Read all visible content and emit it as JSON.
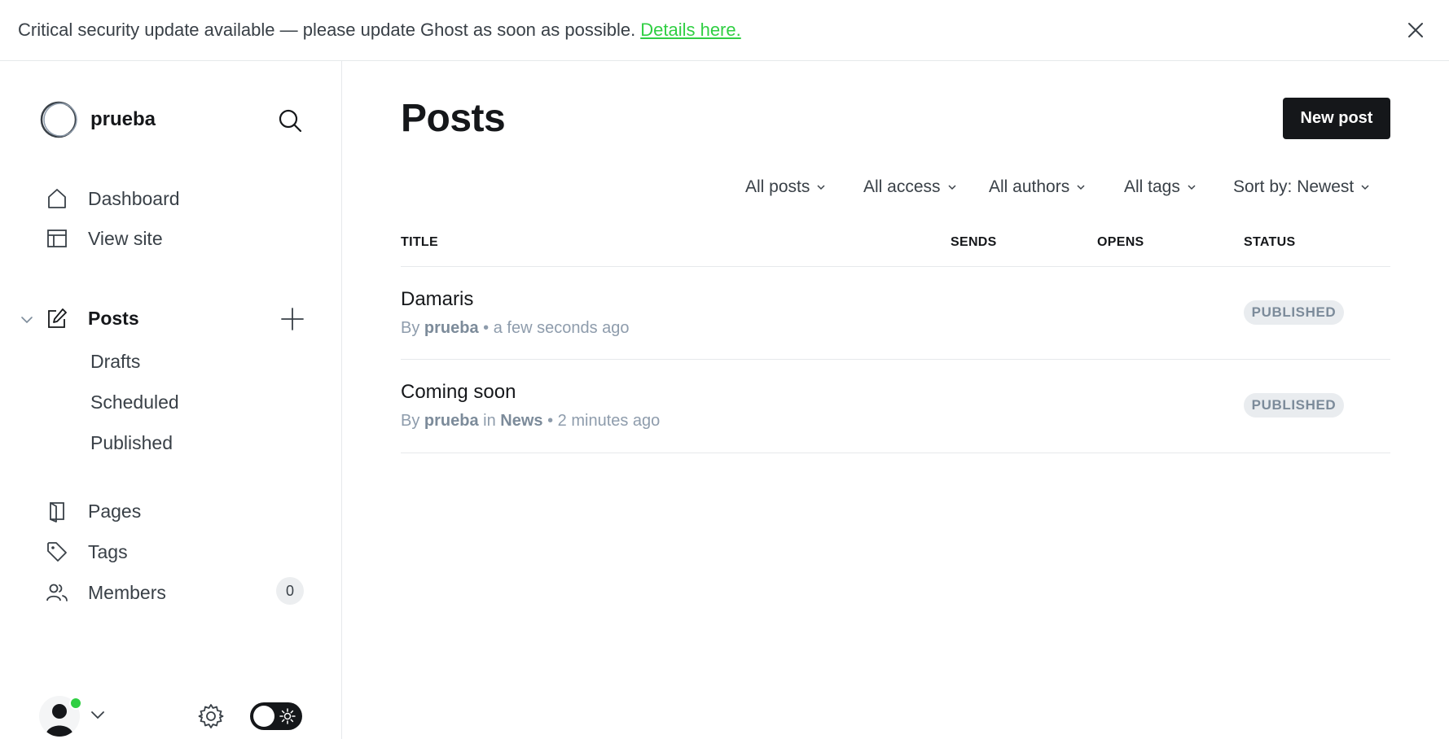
{
  "banner": {
    "message": "Critical security update available — please update Ghost as soon as possible.",
    "link_label": "Details here."
  },
  "site": {
    "name": "prueba"
  },
  "nav": {
    "dashboard": "Dashboard",
    "view_site": "View site",
    "posts": "Posts",
    "drafts": "Drafts",
    "scheduled": "Scheduled",
    "published": "Published",
    "pages": "Pages",
    "tags": "Tags",
    "members": "Members",
    "members_count": "0"
  },
  "main": {
    "title": "Posts",
    "new_post_label": "New post",
    "filters": {
      "type": "All posts",
      "access": "All access",
      "authors": "All authors",
      "tags": "All tags",
      "sort": "Sort by: Newest"
    },
    "columns": {
      "title": "TITLE",
      "sends": "SENDS",
      "opens": "OPENS",
      "status": "STATUS"
    },
    "posts": [
      {
        "title": "Damaris",
        "by": "By",
        "author": "prueba",
        "in": "",
        "tag": "",
        "time": "• a few seconds ago",
        "status": "PUBLISHED"
      },
      {
        "title": "Coming soon",
        "by": "By",
        "author": "prueba",
        "in": "in",
        "tag": "News",
        "time": "• 2 minutes ago",
        "status": "PUBLISHED"
      }
    ]
  },
  "colors": {
    "accent": "#30cf43",
    "dark": "#15171a",
    "badge_bg": "#e9ecef",
    "muted": "#8e9cac"
  }
}
